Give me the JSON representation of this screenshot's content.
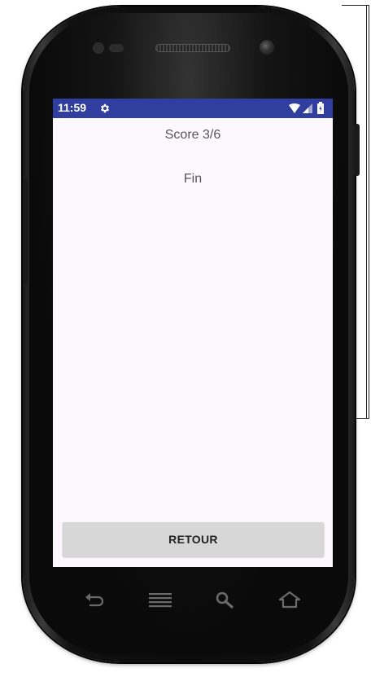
{
  "status_bar": {
    "time": "11:59",
    "icons": [
      "gear-icon",
      "wifi-icon",
      "signal-icon",
      "battery-icon"
    ],
    "background": "#303f9f"
  },
  "screen": {
    "score_label": "Score 3/6",
    "end_label": "Fin",
    "retour_button": "RETOUR",
    "background": "#fdf8fd"
  },
  "hardware_keys": [
    "back-icon",
    "menu-icon",
    "search-icon",
    "home-icon"
  ]
}
